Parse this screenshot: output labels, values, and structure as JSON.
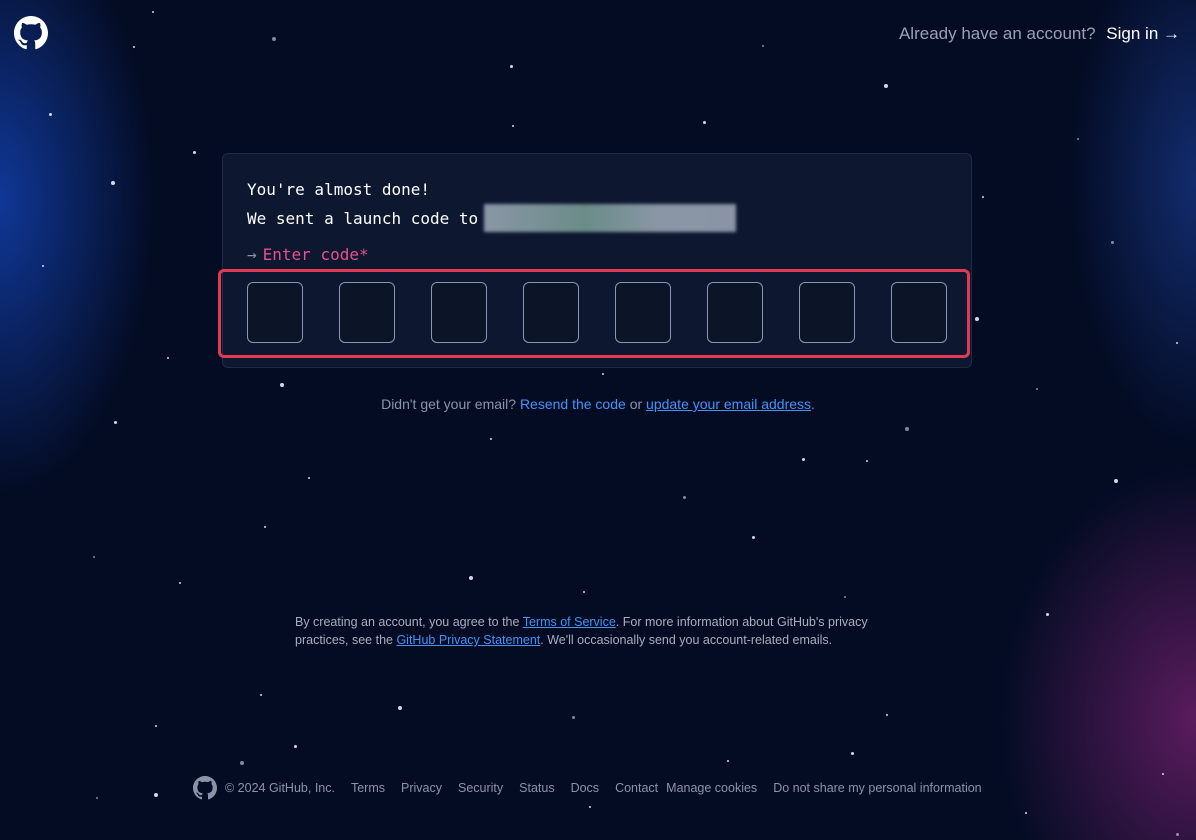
{
  "header": {
    "account_prompt": "Already have an account?",
    "sign_in_label": "Sign in →"
  },
  "card": {
    "line1": "You're almost done!",
    "line2_prefix": "We sent a launch code to",
    "code_label": "Enter code*",
    "code_arrow": "→",
    "code_inputs": [
      "",
      "",
      "",
      "",
      "",
      "",
      "",
      ""
    ]
  },
  "resend": {
    "prefix": "Didn't get your email?",
    "resend_link": "Resend the code",
    "or": "or",
    "update_link": "update your email address",
    "suffix": "."
  },
  "legal": {
    "text1": "By creating an account, you agree to the",
    "terms_link": "Terms of Service",
    "text2": ". For more information about GitHub's privacy practices, see the",
    "privacy_link": "GitHub Privacy Statement",
    "text3": ". We'll occasionally send you account-related emails."
  },
  "footer": {
    "copyright": "© 2024 GitHub, Inc.",
    "links": [
      "Terms",
      "Privacy",
      "Security",
      "Status",
      "Docs",
      "Contact",
      "Manage cookies",
      "Do not share my personal information"
    ]
  },
  "colors": {
    "background": "#040c24",
    "accent_link": "#4493f8",
    "label_pink": "#e7508f",
    "highlight_red": "#e23a55"
  }
}
